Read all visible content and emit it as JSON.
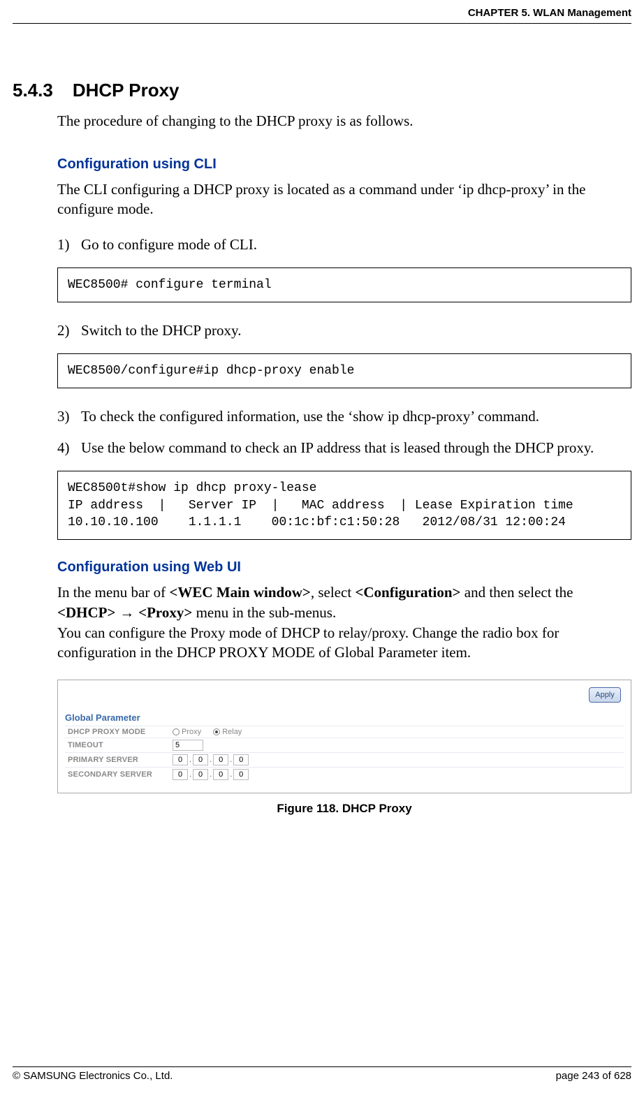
{
  "header": {
    "chapter": "CHAPTER 5. WLAN Management"
  },
  "section": {
    "num": "5.4.3",
    "title": "DHCP Proxy",
    "intro": "The procedure of changing to the DHCP proxy is as follows."
  },
  "cli": {
    "heading": "Configuration using CLI",
    "desc": "The CLI configuring a DHCP proxy is located as a command under ‘ip dhcp-proxy’ in the configure mode.",
    "steps": {
      "s1n": "1)",
      "s1t": "Go to configure mode of CLI.",
      "s2n": "2)",
      "s2t": "Switch to the DHCP proxy.",
      "s3n": "3)",
      "s3t": "To check the configured information, use the ‘show ip dhcp-proxy’ command.",
      "s4n": "4)",
      "s4t": "Use the below command to check an IP address that is leased through the DHCP proxy."
    },
    "code1": "WEC8500# configure terminal",
    "code2": "WEC8500/configure#ip dhcp-proxy enable",
    "code3": "WEC8500t#show ip dhcp proxy-lease\nIP address  |   Server IP  |   MAC address  | Lease Expiration time\n10.10.10.100    1.1.1.1    00:1c:bf:c1:50:28   2012/08/31 12:00:24"
  },
  "web": {
    "heading": "Configuration using Web UI",
    "p1_a": "In the menu bar of ",
    "p1_b": "<WEC Main window>",
    "p1_c": ", select ",
    "p1_d": "<Configuration>",
    "p1_e": " and then select the ",
    "p1_f": "<DHCP>",
    "p1_g": " → ",
    "p1_h": "<Proxy>",
    "p1_i": " menu in the sub-menus.",
    "p2": "You can configure the Proxy mode of DHCP to relay/proxy. Change the radio box for configuration in the DHCP PROXY MODE of Global Parameter item."
  },
  "figure": {
    "apply": "Apply",
    "gp": "Global Parameter",
    "rows": {
      "mode_label": "DHCP PROXY MODE",
      "mode_opt1": "Proxy",
      "mode_opt2": "Relay",
      "timeout_label": "TIMEOUT",
      "timeout_val": "5",
      "primary_label": "PRIMARY SERVER",
      "secondary_label": "SECONDARY SERVER",
      "o1": "0",
      "o2": "0",
      "o3": "0",
      "o4": "0",
      "s1": "0",
      "s2": "0",
      "s3": "0",
      "s4": "0"
    },
    "caption": "Figure 118. DHCP Proxy"
  },
  "footer": {
    "left": "© SAMSUNG Electronics Co., Ltd.",
    "right": "page 243 of 628"
  }
}
